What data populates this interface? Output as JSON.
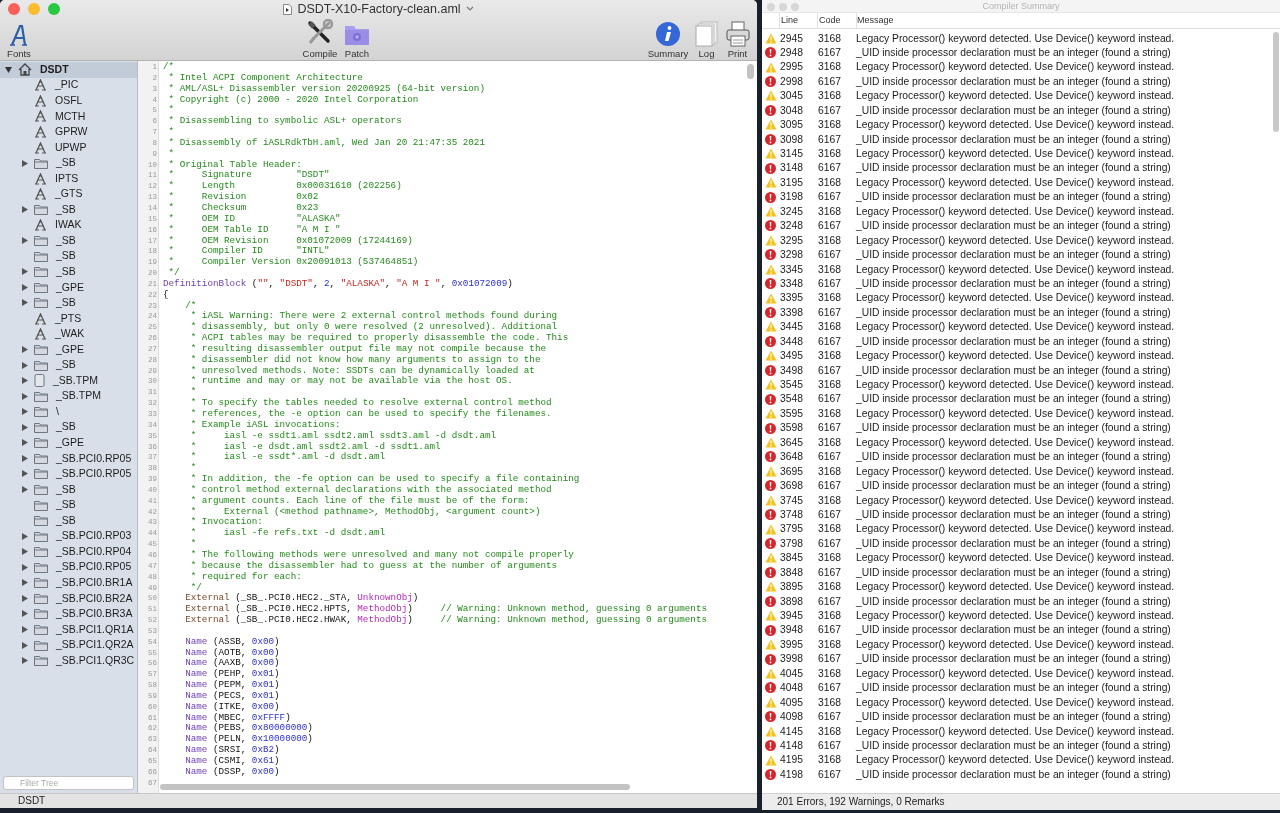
{
  "window": {
    "title": "DSDT-X10-Factory-clean.aml"
  },
  "toolbar": {
    "left": [
      {
        "kind": "fonts",
        "label": "Fonts"
      }
    ],
    "center": [
      {
        "kind": "compile",
        "label": "Compile"
      },
      {
        "kind": "patch",
        "label": "Patch"
      }
    ],
    "right": [
      {
        "kind": "summary",
        "label": "Summary"
      },
      {
        "kind": "log",
        "label": "Log"
      },
      {
        "kind": "print",
        "label": "Print"
      }
    ]
  },
  "tree": {
    "items": [
      {
        "label": "DSDT",
        "kind": "table",
        "selected": true,
        "expanded": true,
        "children": [
          {
            "label": "_PIC",
            "kind": "method",
            "selected": false
          },
          {
            "label": "OSFL",
            "kind": "method",
            "selected": false
          },
          {
            "label": "MCTH",
            "kind": "method",
            "selected": false
          },
          {
            "label": "GPRW",
            "kind": "method",
            "selected": false
          },
          {
            "label": "UPWP",
            "kind": "method",
            "selected": false
          },
          {
            "label": "_SB",
            "kind": "scope",
            "selected": false,
            "expanded": false
          },
          {
            "label": "IPTS",
            "kind": "method",
            "selected": false
          },
          {
            "label": "_GTS",
            "kind": "method",
            "selected": false
          },
          {
            "label": "_SB",
            "kind": "scope",
            "selected": false,
            "expanded": false
          },
          {
            "label": "IWAK",
            "kind": "method",
            "selected": false
          },
          {
            "label": "_SB",
            "kind": "scope",
            "selected": false,
            "expanded": false
          },
          {
            "label": "_SB",
            "kind": "scope",
            "selected": false
          },
          {
            "label": "_SB",
            "kind": "scope",
            "selected": false,
            "expanded": false
          },
          {
            "label": "_GPE",
            "kind": "scope",
            "selected": false,
            "expanded": false
          },
          {
            "label": "_SB",
            "kind": "scope",
            "selected": false,
            "expanded": false
          },
          {
            "label": "_PTS",
            "kind": "method",
            "selected": false
          },
          {
            "label": "_WAK",
            "kind": "method",
            "selected": false
          },
          {
            "label": "_GPE",
            "kind": "scope",
            "selected": false,
            "expanded": false
          },
          {
            "label": "_SB",
            "kind": "scope",
            "selected": false,
            "expanded": false
          },
          {
            "label": "_SB.TPM",
            "kind": "device",
            "selected": false,
            "expanded": false
          },
          {
            "label": "_SB.TPM",
            "kind": "scope",
            "selected": false,
            "expanded": false
          },
          {
            "label": "\\",
            "kind": "scope",
            "selected": false,
            "expanded": false
          },
          {
            "label": "_SB",
            "kind": "scope",
            "selected": false,
            "expanded": false
          },
          {
            "label": "_GPE",
            "kind": "scope",
            "selected": false,
            "expanded": false
          },
          {
            "label": "_SB.PCI0.RP05",
            "kind": "scope",
            "selected": false,
            "expanded": false
          },
          {
            "label": "_SB.PCI0.RP05",
            "kind": "scope",
            "selected": false,
            "expanded": false
          },
          {
            "label": "_SB",
            "kind": "scope",
            "selected": false,
            "expanded": false
          },
          {
            "label": "_SB",
            "kind": "scope",
            "selected": false
          },
          {
            "label": "_SB",
            "kind": "scope",
            "selected": false
          },
          {
            "label": "_SB.PCI0.RP03",
            "kind": "scope",
            "selected": false,
            "expanded": false
          },
          {
            "label": "_SB.PCI0.RP04",
            "kind": "scope",
            "selected": false,
            "expanded": false
          },
          {
            "label": "_SB.PCI0.RP05",
            "kind": "scope",
            "selected": false,
            "expanded": false
          },
          {
            "label": "_SB.PCI0.BR1A",
            "kind": "scope",
            "selected": false,
            "expanded": false
          },
          {
            "label": "_SB.PCI0.BR2A",
            "kind": "scope",
            "selected": false,
            "expanded": false
          },
          {
            "label": "_SB.PCI0.BR3A",
            "kind": "scope",
            "selected": false,
            "expanded": false
          },
          {
            "label": "_SB.PCI1.QR1A",
            "kind": "scope",
            "selected": false,
            "expanded": false
          },
          {
            "label": "_SB.PCI1.QR2A",
            "kind": "scope",
            "selected": false,
            "expanded": false
          },
          {
            "label": "_SB.PCI1.QR3C",
            "kind": "scope",
            "selected": false,
            "expanded": false
          }
        ]
      }
    ]
  },
  "filter": {
    "placeholder": "Filter Tree"
  },
  "editor": {
    "lines": [
      {
        "number": "1",
        "tokens": [
          {
            "kind": "comment",
            "text": "/*"
          }
        ]
      },
      {
        "number": "2",
        "tokens": [
          {
            "kind": "comment",
            "text": " * Intel ACPI Component Architecture"
          }
        ]
      },
      {
        "number": "3",
        "tokens": [
          {
            "kind": "comment",
            "text": " * AML/ASL+ Disassembler version 20200925 (64-bit version)"
          }
        ]
      },
      {
        "number": "4",
        "tokens": [
          {
            "kind": "comment",
            "text": " * Copyright (c) 2000 - 2020 Intel Corporation"
          }
        ]
      },
      {
        "number": "5",
        "tokens": [
          {
            "kind": "comment",
            "text": " *"
          }
        ]
      },
      {
        "number": "6",
        "tokens": [
          {
            "kind": "comment",
            "text": " * Disassembling to symbolic ASL+ operators"
          }
        ]
      },
      {
        "number": "7",
        "tokens": [
          {
            "kind": "comment",
            "text": " *"
          }
        ]
      },
      {
        "number": "8",
        "tokens": [
          {
            "kind": "comment",
            "text": " * Disassembly of iASLRdkTbH.aml, Wed Jan 20 21:47:35 2021"
          }
        ]
      },
      {
        "number": "9",
        "tokens": [
          {
            "kind": "comment",
            "text": " *"
          }
        ]
      },
      {
        "number": "10",
        "tokens": [
          {
            "kind": "comment",
            "text": " * Original Table Header:"
          }
        ]
      },
      {
        "number": "11",
        "tokens": [
          {
            "kind": "comment",
            "text": " *     Signature        \"DSDT\""
          }
        ]
      },
      {
        "number": "12",
        "tokens": [
          {
            "kind": "comment",
            "text": " *     Length           0x00031610 (202256)"
          }
        ]
      },
      {
        "number": "13",
        "tokens": [
          {
            "kind": "comment",
            "text": " *     Revision         0x02"
          }
        ]
      },
      {
        "number": "14",
        "tokens": [
          {
            "kind": "comment",
            "text": " *     Checksum         0x23"
          }
        ]
      },
      {
        "number": "15",
        "tokens": [
          {
            "kind": "comment",
            "text": " *     OEM ID           \"ALASKA\""
          }
        ]
      },
      {
        "number": "16",
        "tokens": [
          {
            "kind": "comment",
            "text": " *     OEM Table ID     \"A M I \""
          }
        ]
      },
      {
        "number": "17",
        "tokens": [
          {
            "kind": "comment",
            "text": " *     OEM Revision     0x01072009 (17244169)"
          }
        ]
      },
      {
        "number": "18",
        "tokens": [
          {
            "kind": "comment",
            "text": " *     Compiler ID      \"INTL\""
          }
        ]
      },
      {
        "number": "19",
        "tokens": [
          {
            "kind": "comment",
            "text": " *     Compiler Version 0x20091013 (537464851)"
          }
        ]
      },
      {
        "number": "20",
        "tokens": [
          {
            "kind": "comment",
            "text": " */"
          }
        ]
      },
      {
        "number": "21",
        "tokens": [
          {
            "kind": "keyword",
            "text": "DefinitionBlock"
          },
          {
            "kind": "plain",
            "text": " ("
          },
          {
            "kind": "string",
            "text": "\"\""
          },
          {
            "kind": "plain",
            "text": ", "
          },
          {
            "kind": "string",
            "text": "\"DSDT\""
          },
          {
            "kind": "plain",
            "text": ", "
          },
          {
            "kind": "number",
            "text": "2"
          },
          {
            "kind": "plain",
            "text": ", "
          },
          {
            "kind": "string",
            "text": "\"ALASKA\""
          },
          {
            "kind": "plain",
            "text": ", "
          },
          {
            "kind": "string",
            "text": "\"A M I \""
          },
          {
            "kind": "plain",
            "text": ", "
          },
          {
            "kind": "number",
            "text": "0x01072009"
          },
          {
            "kind": "plain",
            "text": ")"
          }
        ]
      },
      {
        "number": "22",
        "tokens": [
          {
            "kind": "plain",
            "text": "{"
          }
        ]
      },
      {
        "number": "23",
        "tokens": [
          {
            "kind": "comment",
            "text": "    /*"
          }
        ]
      },
      {
        "number": "24",
        "tokens": [
          {
            "kind": "comment",
            "text": "     * iASL Warning: There were 2 external control methods found during"
          }
        ]
      },
      {
        "number": "25",
        "tokens": [
          {
            "kind": "comment",
            "text": "     * disassembly, but only 0 were resolved (2 unresolved). Additional"
          }
        ]
      },
      {
        "number": "26",
        "tokens": [
          {
            "kind": "comment",
            "text": "     * ACPI tables may be required to properly disassemble the code. This"
          }
        ]
      },
      {
        "number": "27",
        "tokens": [
          {
            "kind": "comment",
            "text": "     * resulting disassembler output file may not compile because the"
          }
        ]
      },
      {
        "number": "28",
        "tokens": [
          {
            "kind": "comment",
            "text": "     * disassembler did not know how many arguments to assign to the"
          }
        ]
      },
      {
        "number": "29",
        "tokens": [
          {
            "kind": "comment",
            "text": "     * unresolved methods. Note: SSDTs can be dynamically loaded at"
          }
        ]
      },
      {
        "number": "30",
        "tokens": [
          {
            "kind": "comment",
            "text": "     * runtime and may or may not be available via the host OS."
          }
        ]
      },
      {
        "number": "31",
        "tokens": [
          {
            "kind": "comment",
            "text": "     *"
          }
        ]
      },
      {
        "number": "32",
        "tokens": [
          {
            "kind": "comment",
            "text": "     * To specify the tables needed to resolve external control method"
          }
        ]
      },
      {
        "number": "33",
        "tokens": [
          {
            "kind": "comment",
            "text": "     * references, the -e option can be used to specify the filenames."
          }
        ]
      },
      {
        "number": "34",
        "tokens": [
          {
            "kind": "comment",
            "text": "     * Example iASL invocations:"
          }
        ]
      },
      {
        "number": "35",
        "tokens": [
          {
            "kind": "comment",
            "text": "     *     iasl -e ssdt1.aml ssdt2.aml ssdt3.aml -d dsdt.aml"
          }
        ]
      },
      {
        "number": "36",
        "tokens": [
          {
            "kind": "comment",
            "text": "     *     iasl -e dsdt.aml ssdt2.aml -d ssdt1.aml"
          }
        ]
      },
      {
        "number": "37",
        "tokens": [
          {
            "kind": "comment",
            "text": "     *     iasl -e ssdt*.aml -d dsdt.aml"
          }
        ]
      },
      {
        "number": "38",
        "tokens": [
          {
            "kind": "comment",
            "text": "     *"
          }
        ]
      },
      {
        "number": "39",
        "tokens": [
          {
            "kind": "comment",
            "text": "     * In addition, the -fe option can be used to specify a file containing"
          }
        ]
      },
      {
        "number": "40",
        "tokens": [
          {
            "kind": "comment",
            "text": "     * control method external declarations with the associated method"
          }
        ]
      },
      {
        "number": "41",
        "tokens": [
          {
            "kind": "comment",
            "text": "     * argument counts. Each line of the file must be of the form:"
          }
        ]
      },
      {
        "number": "42",
        "tokens": [
          {
            "kind": "comment",
            "text": "     *     External (<method pathname>, MethodObj, <argument count>)"
          }
        ]
      },
      {
        "number": "43",
        "tokens": [
          {
            "kind": "comment",
            "text": "     * Invocation:"
          }
        ]
      },
      {
        "number": "44",
        "tokens": [
          {
            "kind": "comment",
            "text": "     *     iasl -fe refs.txt -d dsdt.aml"
          }
        ]
      },
      {
        "number": "45",
        "tokens": [
          {
            "kind": "comment",
            "text": "     *"
          }
        ]
      },
      {
        "number": "46",
        "tokens": [
          {
            "kind": "comment",
            "text": "     * The following methods were unresolved and many not compile properly"
          }
        ]
      },
      {
        "number": "47",
        "tokens": [
          {
            "kind": "comment",
            "text": "     * because the disassembler had to guess at the number of arguments"
          }
        ]
      },
      {
        "number": "48",
        "tokens": [
          {
            "kind": "comment",
            "text": "     * required for each:"
          }
        ]
      },
      {
        "number": "49",
        "tokens": [
          {
            "kind": "comment",
            "text": "     */"
          }
        ]
      },
      {
        "number": "50",
        "tokens": [
          {
            "kind": "external",
            "text": "    External"
          },
          {
            "kind": "plain",
            "text": " (_SB_.PCI0.HEC2._STA, "
          },
          {
            "kind": "type",
            "text": "UnknownObj"
          },
          {
            "kind": "plain",
            "text": ")"
          }
        ]
      },
      {
        "number": "51",
        "tokens": [
          {
            "kind": "external",
            "text": "    External"
          },
          {
            "kind": "plain",
            "text": " (_SB_.PCI0.HEC2.HPTS, "
          },
          {
            "kind": "type",
            "text": "MethodObj"
          },
          {
            "kind": "plain",
            "text": ")"
          },
          {
            "kind": "comment",
            "text": "     // Warning: Unknown method, guessing 0 arguments"
          }
        ]
      },
      {
        "number": "52",
        "tokens": [
          {
            "kind": "external",
            "text": "    External"
          },
          {
            "kind": "plain",
            "text": " (_SB_.PCI0.HEC2.HWAK, "
          },
          {
            "kind": "type",
            "text": "MethodObj"
          },
          {
            "kind": "plain",
            "text": ")"
          },
          {
            "kind": "comment",
            "text": "     // Warning: Unknown method, guessing 0 arguments"
          }
        ]
      },
      {
        "number": "53"
      },
      {
        "number": "54",
        "tokens": [
          {
            "kind": "keyword",
            "text": "    Name"
          },
          {
            "kind": "plain",
            "text": " (ASSB, "
          },
          {
            "kind": "number",
            "text": "0x00"
          },
          {
            "kind": "plain",
            "text": ")"
          }
        ]
      },
      {
        "number": "55",
        "tokens": [
          {
            "kind": "keyword",
            "text": "    Name"
          },
          {
            "kind": "plain",
            "text": " (AOTB, "
          },
          {
            "kind": "number",
            "text": "0x00"
          },
          {
            "kind": "plain",
            "text": ")"
          }
        ]
      },
      {
        "number": "56",
        "tokens": [
          {
            "kind": "keyword",
            "text": "    Name"
          },
          {
            "kind": "plain",
            "text": " (AAXB, "
          },
          {
            "kind": "number",
            "text": "0x00"
          },
          {
            "kind": "plain",
            "text": ")"
          }
        ]
      },
      {
        "number": "57",
        "tokens": [
          {
            "kind": "keyword",
            "text": "    Name"
          },
          {
            "kind": "plain",
            "text": " (PEHP, "
          },
          {
            "kind": "number",
            "text": "0x01"
          },
          {
            "kind": "plain",
            "text": ")"
          }
        ]
      },
      {
        "number": "58",
        "tokens": [
          {
            "kind": "keyword",
            "text": "    Name"
          },
          {
            "kind": "plain",
            "text": " (PEPM, "
          },
          {
            "kind": "number",
            "text": "0x01"
          },
          {
            "kind": "plain",
            "text": ")"
          }
        ]
      },
      {
        "number": "59",
        "tokens": [
          {
            "kind": "keyword",
            "text": "    Name"
          },
          {
            "kind": "plain",
            "text": " (PECS, "
          },
          {
            "kind": "number",
            "text": "0x01"
          },
          {
            "kind": "plain",
            "text": ")"
          }
        ]
      },
      {
        "number": "60",
        "tokens": [
          {
            "kind": "keyword",
            "text": "    Name"
          },
          {
            "kind": "plain",
            "text": " (ITKE, "
          },
          {
            "kind": "number",
            "text": "0x00"
          },
          {
            "kind": "plain",
            "text": ")"
          }
        ]
      },
      {
        "number": "61",
        "tokens": [
          {
            "kind": "keyword",
            "text": "    Name"
          },
          {
            "kind": "plain",
            "text": " (MBEC, "
          },
          {
            "kind": "number",
            "text": "0xFFFF"
          },
          {
            "kind": "plain",
            "text": ")"
          }
        ]
      },
      {
        "number": "62",
        "tokens": [
          {
            "kind": "keyword",
            "text": "    Name"
          },
          {
            "kind": "plain",
            "text": " (PEBS, "
          },
          {
            "kind": "number",
            "text": "0x80000000"
          },
          {
            "kind": "plain",
            "text": ")"
          }
        ]
      },
      {
        "number": "63",
        "tokens": [
          {
            "kind": "keyword",
            "text": "    Name"
          },
          {
            "kind": "plain",
            "text": " (PELN, "
          },
          {
            "kind": "number",
            "text": "0x10000000"
          },
          {
            "kind": "plain",
            "text": ")"
          }
        ]
      },
      {
        "number": "64",
        "tokens": [
          {
            "kind": "keyword",
            "text": "    Name"
          },
          {
            "kind": "plain",
            "text": " (SRSI, "
          },
          {
            "kind": "number",
            "text": "0xB2"
          },
          {
            "kind": "plain",
            "text": ")"
          }
        ]
      },
      {
        "number": "65",
        "tokens": [
          {
            "kind": "keyword",
            "text": "    Name"
          },
          {
            "kind": "plain",
            "text": " (CSMI, "
          },
          {
            "kind": "number",
            "text": "0x61"
          },
          {
            "kind": "plain",
            "text": ")"
          }
        ]
      },
      {
        "number": "66",
        "tokens": [
          {
            "kind": "keyword",
            "text": "    Name"
          },
          {
            "kind": "plain",
            "text": " (DSSP, "
          },
          {
            "kind": "number",
            "text": "0x00"
          },
          {
            "kind": "plain",
            "text": ")"
          }
        ]
      },
      {
        "number": "67"
      }
    ]
  },
  "status_bar": "DSDT",
  "summary": {
    "title": "Compiler Summary",
    "columns": [
      "Line",
      "Code",
      "Message"
    ],
    "rows": [
      {
        "kind": "warning",
        "line": "2945",
        "code": "3168",
        "message": "Legacy Processor() keyword detected. Use Device() keyword instead."
      },
      {
        "kind": "error",
        "line": "2948",
        "code": "6167",
        "message": "_UID inside processor declaration must be an integer (found a string)"
      },
      {
        "kind": "warning",
        "line": "2995",
        "code": "3168",
        "message": "Legacy Processor() keyword detected. Use Device() keyword instead."
      },
      {
        "kind": "error",
        "line": "2998",
        "code": "6167",
        "message": "_UID inside processor declaration must be an integer (found a string)"
      },
      {
        "kind": "warning",
        "line": "3045",
        "code": "3168",
        "message": "Legacy Processor() keyword detected. Use Device() keyword instead."
      },
      {
        "kind": "error",
        "line": "3048",
        "code": "6167",
        "message": "_UID inside processor declaration must be an integer (found a string)"
      },
      {
        "kind": "warning",
        "line": "3095",
        "code": "3168",
        "message": "Legacy Processor() keyword detected. Use Device() keyword instead."
      },
      {
        "kind": "error",
        "line": "3098",
        "code": "6167",
        "message": "_UID inside processor declaration must be an integer (found a string)"
      },
      {
        "kind": "warning",
        "line": "3145",
        "code": "3168",
        "message": "Legacy Processor() keyword detected. Use Device() keyword instead."
      },
      {
        "kind": "error",
        "line": "3148",
        "code": "6167",
        "message": "_UID inside processor declaration must be an integer (found a string)"
      },
      {
        "kind": "warning",
        "line": "3195",
        "code": "3168",
        "message": "Legacy Processor() keyword detected. Use Device() keyword instead."
      },
      {
        "kind": "error",
        "line": "3198",
        "code": "6167",
        "message": "_UID inside processor declaration must be an integer (found a string)"
      },
      {
        "kind": "warning",
        "line": "3245",
        "code": "3168",
        "message": "Legacy Processor() keyword detected. Use Device() keyword instead."
      },
      {
        "kind": "error",
        "line": "3248",
        "code": "6167",
        "message": "_UID inside processor declaration must be an integer (found a string)"
      },
      {
        "kind": "warning",
        "line": "3295",
        "code": "3168",
        "message": "Legacy Processor() keyword detected. Use Device() keyword instead."
      },
      {
        "kind": "error",
        "line": "3298",
        "code": "6167",
        "message": "_UID inside processor declaration must be an integer (found a string)"
      },
      {
        "kind": "warning",
        "line": "3345",
        "code": "3168",
        "message": "Legacy Processor() keyword detected. Use Device() keyword instead."
      },
      {
        "kind": "error",
        "line": "3348",
        "code": "6167",
        "message": "_UID inside processor declaration must be an integer (found a string)"
      },
      {
        "kind": "warning",
        "line": "3395",
        "code": "3168",
        "message": "Legacy Processor() keyword detected. Use Device() keyword instead."
      },
      {
        "kind": "error",
        "line": "3398",
        "code": "6167",
        "message": "_UID inside processor declaration must be an integer (found a string)"
      },
      {
        "kind": "warning",
        "line": "3445",
        "code": "3168",
        "message": "Legacy Processor() keyword detected. Use Device() keyword instead."
      },
      {
        "kind": "error",
        "line": "3448",
        "code": "6167",
        "message": "_UID inside processor declaration must be an integer (found a string)"
      },
      {
        "kind": "warning",
        "line": "3495",
        "code": "3168",
        "message": "Legacy Processor() keyword detected. Use Device() keyword instead."
      },
      {
        "kind": "error",
        "line": "3498",
        "code": "6167",
        "message": "_UID inside processor declaration must be an integer (found a string)"
      },
      {
        "kind": "warning",
        "line": "3545",
        "code": "3168",
        "message": "Legacy Processor() keyword detected. Use Device() keyword instead."
      },
      {
        "kind": "error",
        "line": "3548",
        "code": "6167",
        "message": "_UID inside processor declaration must be an integer (found a string)"
      },
      {
        "kind": "warning",
        "line": "3595",
        "code": "3168",
        "message": "Legacy Processor() keyword detected. Use Device() keyword instead."
      },
      {
        "kind": "error",
        "line": "3598",
        "code": "6167",
        "message": "_UID inside processor declaration must be an integer (found a string)"
      },
      {
        "kind": "warning",
        "line": "3645",
        "code": "3168",
        "message": "Legacy Processor() keyword detected. Use Device() keyword instead."
      },
      {
        "kind": "error",
        "line": "3648",
        "code": "6167",
        "message": "_UID inside processor declaration must be an integer (found a string)"
      },
      {
        "kind": "warning",
        "line": "3695",
        "code": "3168",
        "message": "Legacy Processor() keyword detected. Use Device() keyword instead."
      },
      {
        "kind": "error",
        "line": "3698",
        "code": "6167",
        "message": "_UID inside processor declaration must be an integer (found a string)"
      },
      {
        "kind": "warning",
        "line": "3745",
        "code": "3168",
        "message": "Legacy Processor() keyword detected. Use Device() keyword instead."
      },
      {
        "kind": "error",
        "line": "3748",
        "code": "6167",
        "message": "_UID inside processor declaration must be an integer (found a string)"
      },
      {
        "kind": "warning",
        "line": "3795",
        "code": "3168",
        "message": "Legacy Processor() keyword detected. Use Device() keyword instead."
      },
      {
        "kind": "error",
        "line": "3798",
        "code": "6167",
        "message": "_UID inside processor declaration must be an integer (found a string)"
      },
      {
        "kind": "warning",
        "line": "3845",
        "code": "3168",
        "message": "Legacy Processor() keyword detected. Use Device() keyword instead."
      },
      {
        "kind": "error",
        "line": "3848",
        "code": "6167",
        "message": "_UID inside processor declaration must be an integer (found a string)"
      },
      {
        "kind": "warning",
        "line": "3895",
        "code": "3168",
        "message": "Legacy Processor() keyword detected. Use Device() keyword instead."
      },
      {
        "kind": "error",
        "line": "3898",
        "code": "6167",
        "message": "_UID inside processor declaration must be an integer (found a string)"
      },
      {
        "kind": "warning",
        "line": "3945",
        "code": "3168",
        "message": "Legacy Processor() keyword detected. Use Device() keyword instead."
      },
      {
        "kind": "error",
        "line": "3948",
        "code": "6167",
        "message": "_UID inside processor declaration must be an integer (found a string)"
      },
      {
        "kind": "warning",
        "line": "3995",
        "code": "3168",
        "message": "Legacy Processor() keyword detected. Use Device() keyword instead."
      },
      {
        "kind": "error",
        "line": "3998",
        "code": "6167",
        "message": "_UID inside processor declaration must be an integer (found a string)"
      },
      {
        "kind": "warning",
        "line": "4045",
        "code": "3168",
        "message": "Legacy Processor() keyword detected. Use Device() keyword instead."
      },
      {
        "kind": "error",
        "line": "4048",
        "code": "6167",
        "message": "_UID inside processor declaration must be an integer (found a string)"
      },
      {
        "kind": "warning",
        "line": "4095",
        "code": "3168",
        "message": "Legacy Processor() keyword detected. Use Device() keyword instead."
      },
      {
        "kind": "error",
        "line": "4098",
        "code": "6167",
        "message": "_UID inside processor declaration must be an integer (found a string)"
      },
      {
        "kind": "warning",
        "line": "4145",
        "code": "3168",
        "message": "Legacy Processor() keyword detected. Use Device() keyword instead."
      },
      {
        "kind": "error",
        "line": "4148",
        "code": "6167",
        "message": "_UID inside processor declaration must be an integer (found a string)"
      },
      {
        "kind": "warning",
        "line": "4195",
        "code": "3168",
        "message": "Legacy Processor() keyword detected. Use Device() keyword instead."
      },
      {
        "kind": "error",
        "line": "4198",
        "code": "6167",
        "message": "_UID inside processor declaration must be an integer (found a string)"
      }
    ],
    "footer": "201 Errors, 192 Warnings, 0 Remarks"
  }
}
